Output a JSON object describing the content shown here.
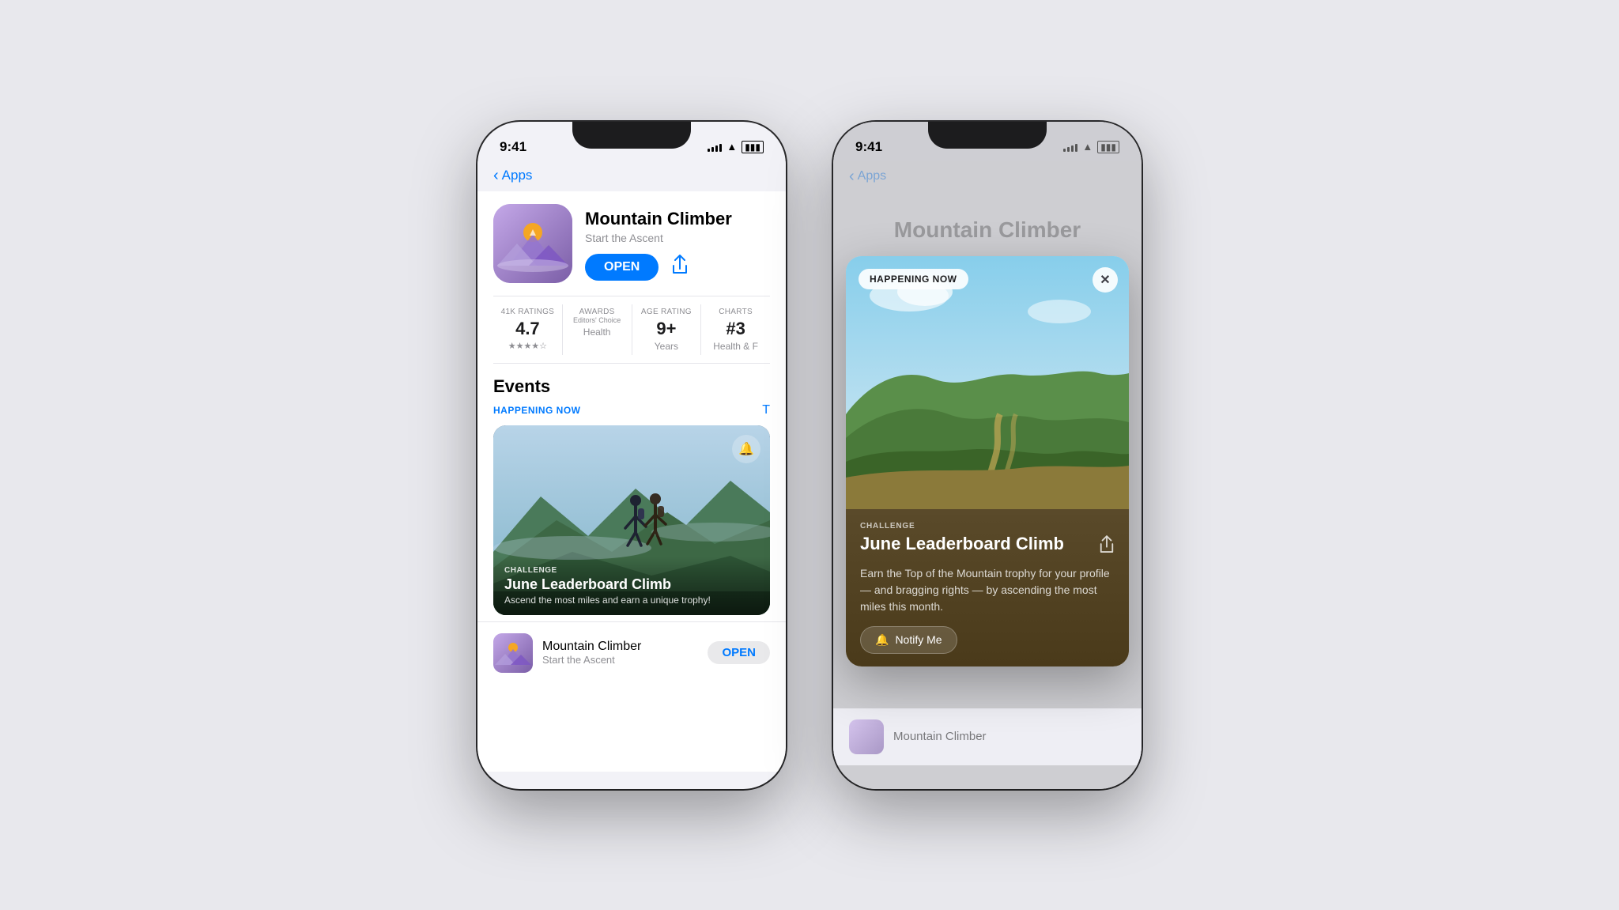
{
  "background": "#e8e8ed",
  "phone1": {
    "status": {
      "time": "9:41",
      "signal": true,
      "wifi": true,
      "battery": true
    },
    "nav": {
      "back_label": "Apps"
    },
    "app": {
      "name": "Mountain Climber",
      "subtitle": "Start the Ascent",
      "open_button": "OPEN",
      "ratings_label": "41K RATINGS",
      "rating_value": "4.7",
      "awards_label": "AWARDS",
      "awards_value": "Editors' Choice",
      "awards_sub": "Health",
      "age_label": "AGE RATING",
      "age_value": "9+",
      "age_sub": "Years",
      "charts_label": "CHARTS",
      "charts_value": "#3",
      "charts_sub": "Health & F"
    },
    "events": {
      "section_title": "Events",
      "badge": "HAPPENING NOW",
      "see_all": "T",
      "card": {
        "type": "CHALLENGE",
        "name": "June Leaderboard Climb",
        "desc": "Ascend the most miles and earn a unique trophy!"
      }
    },
    "mini_card": {
      "name": "Mountain Climber",
      "subtitle": "Start the Ascent",
      "open_button": "OPEN"
    }
  },
  "phone2": {
    "status": {
      "time": "9:41"
    },
    "nav": {
      "back_label": "Apps"
    },
    "behind_title": "Mountain Climber",
    "popup": {
      "badge": "HAPPENING NOW",
      "close_icon": "✕",
      "type": "CHALLENGE",
      "title": "June Leaderboard Climb",
      "share_icon": "⬆",
      "desc": "Earn the Top of the Mountain trophy for your profile — and bragging rights — by ascending the most miles this month.",
      "notify_icon": "🔔",
      "notify_label": "Notify Me"
    }
  }
}
